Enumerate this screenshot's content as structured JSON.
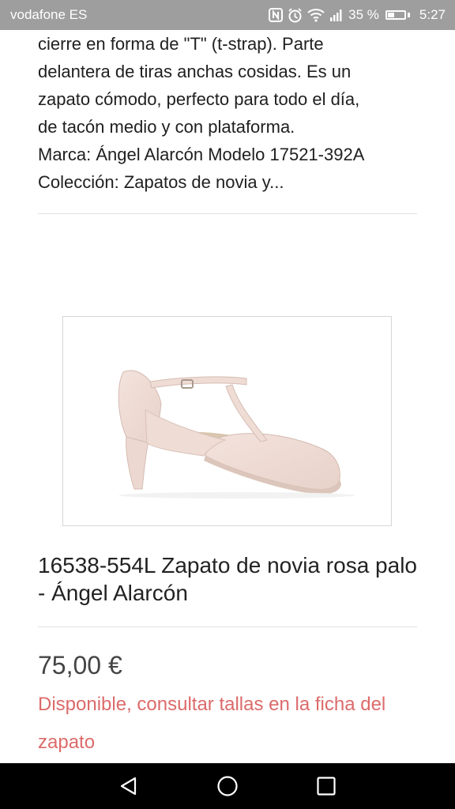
{
  "status_bar": {
    "carrier": "vodafone ES",
    "battery_percent": "35 %",
    "battery_level": 0.35,
    "time": "5:27",
    "icons": [
      "nfc-icon",
      "alarm-icon",
      "wifi-icon",
      "signal-icon",
      "battery-icon"
    ]
  },
  "description": {
    "lines": [
      "cierre en forma de \"T\" (t-strap). Parte",
      "delantera de tiras anchas cosidas. Es un",
      "zapato cómodo, perfecto para todo el día,",
      "de tacón medio y con plataforma.",
      "Marca: Ángel Alarcón  Modelo 17521-392A",
      "Colección: Zapatos de novia y..."
    ]
  },
  "product": {
    "image_name": "pink-tstrap-shoe",
    "title": "16538-554L Zapato de novia rosa palo - Ángel Alarcón",
    "price": "75,00 €",
    "availability": "Disponible, consultar tallas en la ficha del zapato"
  },
  "nav_bar": {
    "icons": [
      "back-icon",
      "home-icon",
      "recents-icon"
    ]
  },
  "colors": {
    "status_bar": "#9e9e9e",
    "availability": "#dc6a6a",
    "nav_bar": "#000000"
  }
}
